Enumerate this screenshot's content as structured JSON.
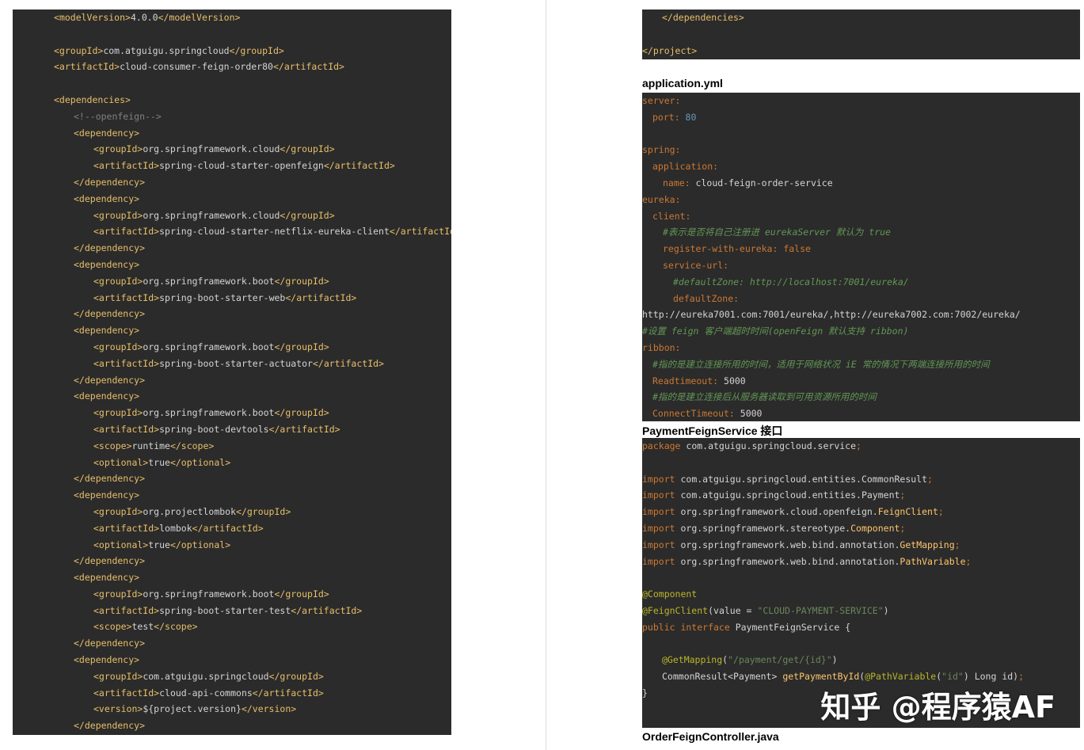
{
  "left_pom": [
    {
      "indent": 1,
      "parts": [
        [
          "t",
          "<"
        ],
        [
          "t",
          "modelVersion"
        ],
        [
          "t",
          ">"
        ],
        [
          "v",
          "4.0.0"
        ],
        [
          "t",
          "</modelVersion>"
        ]
      ]
    },
    {
      "indent": 0,
      "parts": []
    },
    {
      "indent": 1,
      "parts": [
        [
          "t",
          "<groupId>"
        ],
        [
          "v",
          "com.atguigu.springcloud"
        ],
        [
          "t",
          "</groupId>"
        ]
      ]
    },
    {
      "indent": 1,
      "parts": [
        [
          "t",
          "<artifactId>"
        ],
        [
          "v",
          "cloud-consumer-feign-order80"
        ],
        [
          "t",
          "</artifactId>"
        ]
      ]
    },
    {
      "indent": 0,
      "parts": []
    },
    {
      "indent": 1,
      "parts": [
        [
          "t",
          "<dependencies>"
        ]
      ]
    },
    {
      "indent": 2,
      "parts": [
        [
          "c",
          "<!--openfeign-->"
        ]
      ]
    },
    {
      "indent": 2,
      "parts": [
        [
          "t",
          "<dependency>"
        ]
      ]
    },
    {
      "indent": 3,
      "parts": [
        [
          "t",
          "<groupId>"
        ],
        [
          "v",
          "org.springframework.cloud"
        ],
        [
          "t",
          "</groupId>"
        ]
      ]
    },
    {
      "indent": 3,
      "parts": [
        [
          "t",
          "<artifactId>"
        ],
        [
          "v",
          "spring-cloud-starter-openfeign"
        ],
        [
          "t",
          "</artifactId>"
        ]
      ]
    },
    {
      "indent": 2,
      "parts": [
        [
          "t",
          "</dependency>"
        ]
      ]
    },
    {
      "indent": 2,
      "parts": [
        [
          "t",
          "<dependency>"
        ]
      ]
    },
    {
      "indent": 3,
      "parts": [
        [
          "t",
          "<groupId>"
        ],
        [
          "v",
          "org.springframework.cloud"
        ],
        [
          "t",
          "</groupId>"
        ]
      ]
    },
    {
      "indent": 3,
      "parts": [
        [
          "t",
          "<artifactId>"
        ],
        [
          "v",
          "spring-cloud-starter-netflix-eureka-client"
        ],
        [
          "t",
          "</artifactId>"
        ]
      ]
    },
    {
      "indent": 2,
      "parts": [
        [
          "t",
          "</dependency>"
        ]
      ]
    },
    {
      "indent": 2,
      "parts": [
        [
          "t",
          "<dependency>"
        ]
      ]
    },
    {
      "indent": 3,
      "parts": [
        [
          "t",
          "<groupId>"
        ],
        [
          "v",
          "org.springframework.boot"
        ],
        [
          "t",
          "</groupId>"
        ]
      ]
    },
    {
      "indent": 3,
      "parts": [
        [
          "t",
          "<artifactId>"
        ],
        [
          "v",
          "spring-boot-starter-web"
        ],
        [
          "t",
          "</artifactId>"
        ]
      ]
    },
    {
      "indent": 2,
      "parts": [
        [
          "t",
          "</dependency>"
        ]
      ]
    },
    {
      "indent": 2,
      "parts": [
        [
          "t",
          "<dependency>"
        ]
      ]
    },
    {
      "indent": 3,
      "parts": [
        [
          "t",
          "<groupId>"
        ],
        [
          "v",
          "org.springframework.boot"
        ],
        [
          "t",
          "</groupId>"
        ]
      ]
    },
    {
      "indent": 3,
      "parts": [
        [
          "t",
          "<artifactId>"
        ],
        [
          "v",
          "spring-boot-starter-actuator"
        ],
        [
          "t",
          "</artifactId>"
        ]
      ]
    },
    {
      "indent": 2,
      "parts": [
        [
          "t",
          "</dependency>"
        ]
      ]
    },
    {
      "indent": 2,
      "parts": [
        [
          "t",
          "<dependency>"
        ]
      ]
    },
    {
      "indent": 3,
      "parts": [
        [
          "t",
          "<groupId>"
        ],
        [
          "v",
          "org.springframework.boot"
        ],
        [
          "t",
          "</groupId>"
        ]
      ]
    },
    {
      "indent": 3,
      "parts": [
        [
          "t",
          "<artifactId>"
        ],
        [
          "v",
          "spring-boot-devtools"
        ],
        [
          "t",
          "</artifactId>"
        ]
      ]
    },
    {
      "indent": 3,
      "parts": [
        [
          "t",
          "<scope>"
        ],
        [
          "v",
          "runtime"
        ],
        [
          "t",
          "</scope>"
        ]
      ]
    },
    {
      "indent": 3,
      "parts": [
        [
          "t",
          "<optional>"
        ],
        [
          "v",
          "true"
        ],
        [
          "t",
          "</optional>"
        ]
      ]
    },
    {
      "indent": 2,
      "parts": [
        [
          "t",
          "</dependency>"
        ]
      ]
    },
    {
      "indent": 2,
      "parts": [
        [
          "t",
          "<dependency>"
        ]
      ]
    },
    {
      "indent": 3,
      "parts": [
        [
          "t",
          "<groupId>"
        ],
        [
          "v",
          "org.projectlombok"
        ],
        [
          "t",
          "</groupId>"
        ]
      ]
    },
    {
      "indent": 3,
      "parts": [
        [
          "t",
          "<artifactId>"
        ],
        [
          "v",
          "lombok"
        ],
        [
          "t",
          "</artifactId>"
        ]
      ]
    },
    {
      "indent": 3,
      "parts": [
        [
          "t",
          "<optional>"
        ],
        [
          "v",
          "true"
        ],
        [
          "t",
          "</optional>"
        ]
      ]
    },
    {
      "indent": 2,
      "parts": [
        [
          "t",
          "</dependency>"
        ]
      ]
    },
    {
      "indent": 2,
      "parts": [
        [
          "t",
          "<dependency>"
        ]
      ]
    },
    {
      "indent": 3,
      "parts": [
        [
          "t",
          "<groupId>"
        ],
        [
          "v",
          "org.springframework.boot"
        ],
        [
          "t",
          "</groupId>"
        ]
      ]
    },
    {
      "indent": 3,
      "parts": [
        [
          "t",
          "<artifactId>"
        ],
        [
          "v",
          "spring-boot-starter-test"
        ],
        [
          "t",
          "</artifactId>"
        ]
      ]
    },
    {
      "indent": 3,
      "parts": [
        [
          "t",
          "<scope>"
        ],
        [
          "v",
          "test"
        ],
        [
          "t",
          "</scope>"
        ]
      ]
    },
    {
      "indent": 2,
      "parts": [
        [
          "t",
          "</dependency>"
        ]
      ]
    },
    {
      "indent": 2,
      "parts": [
        [
          "t",
          "<dependency>"
        ]
      ]
    },
    {
      "indent": 3,
      "parts": [
        [
          "t",
          "<groupId>"
        ],
        [
          "v",
          "com.atguigu.springcloud"
        ],
        [
          "t",
          "</groupId>"
        ]
      ]
    },
    {
      "indent": 3,
      "parts": [
        [
          "t",
          "<artifactId>"
        ],
        [
          "v",
          "cloud-api-commons"
        ],
        [
          "t",
          "</artifactId>"
        ]
      ]
    },
    {
      "indent": 3,
      "parts": [
        [
          "t",
          "<version>"
        ],
        [
          "v",
          "${project.version}"
        ],
        [
          "t",
          "</version>"
        ]
      ]
    },
    {
      "indent": 2,
      "parts": [
        [
          "t",
          "</dependency>"
        ]
      ]
    }
  ],
  "right_pom_tail": [
    {
      "indent": 1,
      "parts": [
        [
          "t",
          "</dependencies>"
        ]
      ]
    },
    {
      "indent": 0,
      "parts": []
    },
    {
      "indent": 0,
      "parts": [
        [
          "t",
          "</project>"
        ]
      ]
    }
  ],
  "headings": {
    "yml": "application.yml",
    "feign_service": "PaymentFeignService 接口",
    "controller": "OrderFeignController.java"
  },
  "yaml": [
    {
      "indent": 0,
      "parts": [
        [
          "k",
          "server:"
        ]
      ]
    },
    {
      "indent": 1,
      "parts": [
        [
          "k",
          "port: "
        ],
        [
          "n",
          "80"
        ]
      ]
    },
    {
      "indent": 0,
      "parts": []
    },
    {
      "indent": 0,
      "parts": [
        [
          "k",
          "spring:"
        ]
      ]
    },
    {
      "indent": 1,
      "parts": [
        [
          "k",
          "application:"
        ]
      ]
    },
    {
      "indent": 2,
      "parts": [
        [
          "k",
          "name: "
        ],
        [
          "v",
          "cloud-feign-order-service"
        ]
      ]
    },
    {
      "indent": 0,
      "parts": [
        [
          "k",
          "eureka:"
        ]
      ]
    },
    {
      "indent": 1,
      "parts": [
        [
          "k",
          "client:"
        ]
      ]
    },
    {
      "indent": 2,
      "parts": [
        [
          "cm",
          "#表示是否将自己注册进 eurekaServer 默认为 true"
        ]
      ]
    },
    {
      "indent": 2,
      "parts": [
        [
          "k",
          "register-with-eureka: false"
        ]
      ]
    },
    {
      "indent": 2,
      "parts": [
        [
          "k",
          "service-url:"
        ]
      ]
    },
    {
      "indent": 3,
      "parts": [
        [
          "cm",
          "#defaultZone: http://localhost:7001/eureka/"
        ]
      ]
    },
    {
      "indent": 3,
      "parts": [
        [
          "k",
          "defaultZone:"
        ]
      ]
    },
    {
      "indent": 0,
      "parts": [
        [
          "v",
          "http://eureka7001.com:7001/eureka/,http://eureka7002.com:7002/eureka/"
        ]
      ]
    },
    {
      "indent": 0,
      "parts": [
        [
          "cm",
          "#设置 feign 客户端超时时间(openFeign 默认支持 ribbon)"
        ]
      ]
    },
    {
      "indent": 0,
      "parts": [
        [
          "k",
          "ribbon:"
        ]
      ]
    },
    {
      "indent": 1,
      "parts": [
        [
          "cm",
          "#指的是建立连接所用的时间，适用于网络状况 iE 常的情况下两端连接所用的时间"
        ]
      ]
    },
    {
      "indent": 1,
      "parts": [
        [
          "k",
          "Readtimeout: "
        ],
        [
          "v",
          "5000"
        ]
      ]
    },
    {
      "indent": 1,
      "parts": [
        [
          "cm",
          "#指的是建立连接后从服务器读取到可用资源所用的时间"
        ]
      ]
    },
    {
      "indent": 1,
      "parts": [
        [
          "k",
          "ConnectTimeout: "
        ],
        [
          "v",
          "5000"
        ]
      ]
    }
  ],
  "java": [
    {
      "indent": 0,
      "parts": [
        [
          "k",
          "package "
        ],
        [
          "v",
          "com.atguigu.springcloud.service"
        ],
        [
          "k",
          ";"
        ]
      ]
    },
    {
      "indent": 0,
      "parts": []
    },
    {
      "indent": 0,
      "parts": [
        [
          "k",
          "import "
        ],
        [
          "v",
          "com.atguigu.springcloud.entities.CommonResult"
        ],
        [
          "k",
          ";"
        ]
      ]
    },
    {
      "indent": 0,
      "parts": [
        [
          "k",
          "import "
        ],
        [
          "v",
          "com.atguigu.springcloud.entities.Payment"
        ],
        [
          "k",
          ";"
        ]
      ]
    },
    {
      "indent": 0,
      "parts": [
        [
          "k",
          "import "
        ],
        [
          "v",
          "org.springframework.cloud.openfeign."
        ],
        [
          "cls",
          "FeignClient"
        ],
        [
          "k",
          ";"
        ]
      ]
    },
    {
      "indent": 0,
      "parts": [
        [
          "k",
          "import "
        ],
        [
          "v",
          "org.springframework.stereotype."
        ],
        [
          "cls",
          "Component"
        ],
        [
          "k",
          ";"
        ]
      ]
    },
    {
      "indent": 0,
      "parts": [
        [
          "k",
          "import "
        ],
        [
          "v",
          "org.springframework.web.bind.annotation."
        ],
        [
          "cls",
          "GetMapping"
        ],
        [
          "k",
          ";"
        ]
      ]
    },
    {
      "indent": 0,
      "parts": [
        [
          "k",
          "import "
        ],
        [
          "v",
          "org.springframework.web.bind.annotation."
        ],
        [
          "cls",
          "PathVariable"
        ],
        [
          "k",
          ";"
        ]
      ]
    },
    {
      "indent": 0,
      "parts": []
    },
    {
      "indent": 0,
      "parts": [
        [
          "a",
          "@Component"
        ]
      ]
    },
    {
      "indent": 0,
      "parts": [
        [
          "a",
          "@FeignClient"
        ],
        [
          "v",
          "(value = "
        ],
        [
          "s",
          "\"CLOUD-PAYMENT-SERVICE\""
        ],
        [
          "v",
          ")"
        ]
      ]
    },
    {
      "indent": 0,
      "parts": [
        [
          "k",
          "public interface "
        ],
        [
          "v",
          "PaymentFeignService "
        ],
        [
          "v",
          "{"
        ]
      ]
    },
    {
      "indent": 0,
      "parts": []
    },
    {
      "indent": 1,
      "parts": [
        [
          "a",
          "@GetMapping"
        ],
        [
          "v",
          "("
        ],
        [
          "s",
          "\"/payment/get/{id}\""
        ],
        [
          "v",
          ")"
        ]
      ]
    },
    {
      "indent": 1,
      "parts": [
        [
          "v",
          "CommonResult<Payment> "
        ],
        [
          "cls",
          "getPaymentById"
        ],
        [
          "v",
          "("
        ],
        [
          "a",
          "@PathVariable"
        ],
        [
          "v",
          "("
        ],
        [
          "s",
          "\"id\""
        ],
        [
          "v",
          ") Long id)"
        ],
        [
          "k",
          ";"
        ]
      ]
    },
    {
      "indent": 0,
      "parts": [
        [
          "v",
          "}"
        ]
      ]
    }
  ],
  "watermark": "知乎 @程序猿AF"
}
